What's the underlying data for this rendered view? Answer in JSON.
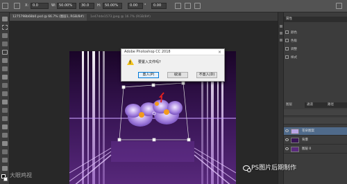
{
  "options_bar": {
    "fields": [
      "0.0",
      "50.00%",
      "30.0",
      "50.00%",
      "0.00",
      "0.00"
    ],
    "labels": [
      "X:",
      "W:",
      "H:",
      "°"
    ]
  },
  "document_tabs": [
    {
      "label": "1275798b68b0.psd @ 66.7% (图层1, RGB/8#)",
      "active": true
    },
    {
      "label": "1e47dde1573.jpeg @ 16.7% (RGB/8#)",
      "active": false
    }
  ],
  "dialog": {
    "title": "Adobe Photoshop CC 2018",
    "close_label": "×",
    "message": "要置入文件吗?",
    "buttons": [
      "置入(P)",
      "取消",
      "不置入(D)"
    ]
  },
  "right_dock": {
    "top_panel_title": "属性",
    "panel_labels": [
      "颜色",
      "色板",
      "调整",
      "样式"
    ],
    "layers_tabs": [
      "图层",
      "通道",
      "路径"
    ],
    "layers": [
      {
        "name": "花朵图案",
        "selected": true
      },
      {
        "name": "背景",
        "selected": false
      },
      {
        "name": "图层 0",
        "selected": false
      }
    ]
  },
  "watermark": {
    "text": "PS图片后期制作",
    "corner_text": "大眼鸡视"
  },
  "icons": {
    "dialog_warning": "warning-icon",
    "wechat": "wechat-icon"
  },
  "colors": {
    "dialog_default_button": "#0078d7",
    "warning": "#f1c21b",
    "canvas_background": "#2a0f3e"
  }
}
